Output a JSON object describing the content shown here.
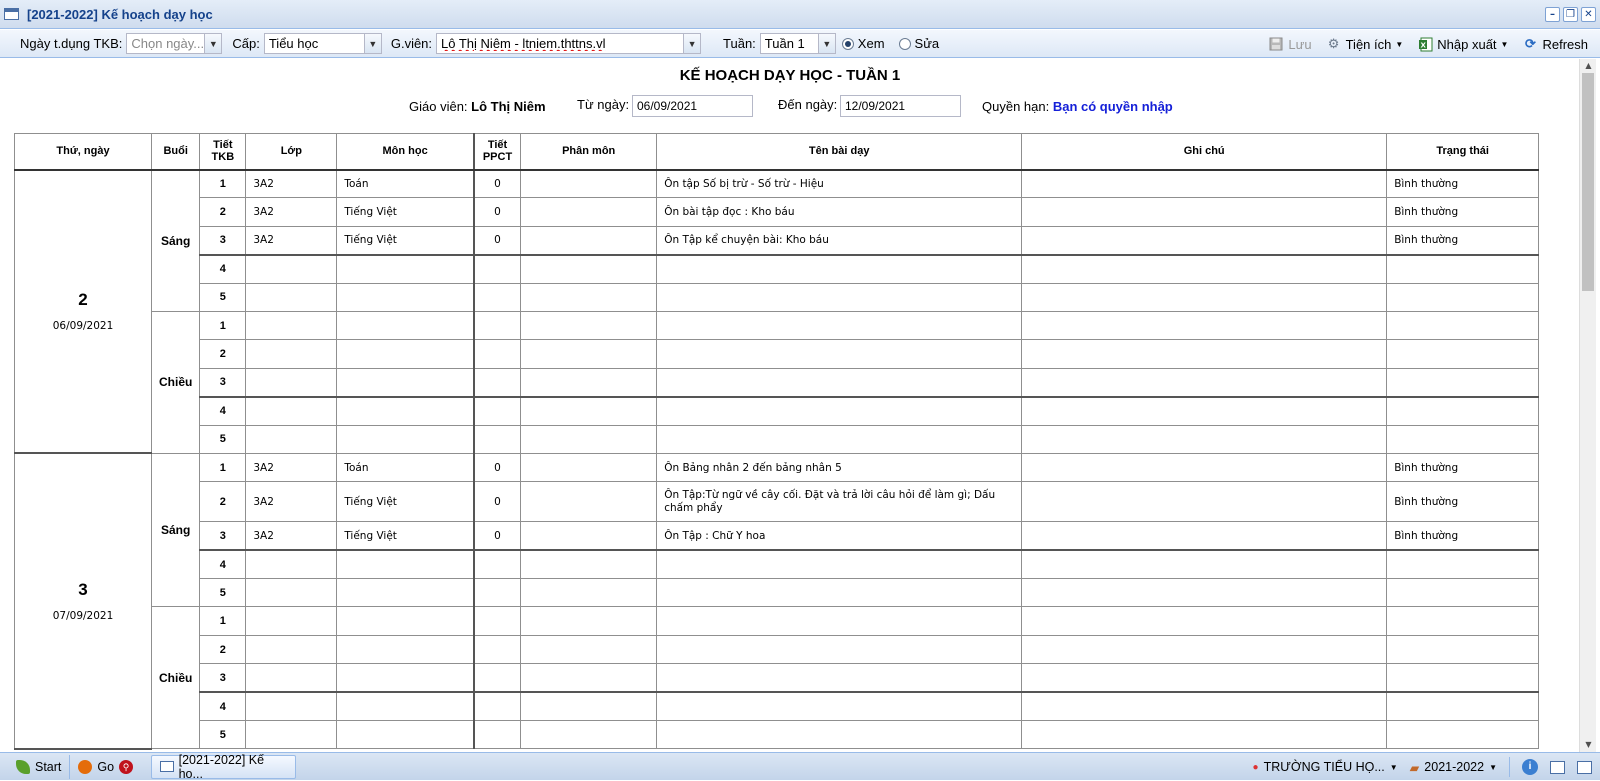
{
  "window": {
    "title": "[2021-2022] Kế hoạch dạy học"
  },
  "toolbar": {
    "ngay_label": "Ngày t.dụng TKB:",
    "ngay_placeholder": "Chọn ngày...",
    "cap_label": "Cấp:",
    "cap_value": "Tiểu học",
    "gv_label": "G.viên:",
    "gv_value": "Lô Thị Niêm - ltniem.thttns.vl",
    "tuan_label": "Tuần:",
    "tuan_value": "Tuần 1",
    "xem_label": "Xem",
    "sua_label": "Sửa",
    "xem_selected": true,
    "luu_label": "Lưu",
    "tienich_label": "Tiện ích",
    "nhapxuat_label": "Nhập xuất",
    "refresh_label": "Refresh"
  },
  "header": {
    "title": "KẾ HOẠCH DẠY HỌC - TUẦN 1",
    "gv_label": "Giáo viên:",
    "gv_name": "Lô Thị Niêm",
    "tu_ngay_label": "Từ ngày:",
    "tu_ngay": "06/09/2021",
    "den_ngay_label": "Đến ngày:",
    "den_ngay": "12/09/2021",
    "quyen_label": "Quyền hạn:",
    "quyen_value": "Bạn có quyền nhập"
  },
  "columns": [
    "Thứ, ngày",
    "Buổi",
    "Tiết TKB",
    "Lớp",
    "Môn học",
    "Tiết PPCT",
    "Phân môn",
    "Tên bài dạy",
    "Ghi chú",
    "Trạng thái"
  ],
  "days": [
    {
      "thu": "2",
      "ngay": "06/09/2021",
      "sessions": [
        {
          "buoi": "Sáng",
          "rows": [
            {
              "tiet": "1",
              "lop": "3A2",
              "mon": "Toán",
              "ppct": "0",
              "phanmon": "",
              "ten": "Ôn tập Số bị trừ - Số trừ - Hiệu",
              "ghichu": "",
              "trangthai": "Bình thường"
            },
            {
              "tiet": "2",
              "lop": "3A2",
              "mon": "Tiếng Việt",
              "ppct": "0",
              "phanmon": "",
              "ten": "Ôn bài tập đọc : Kho báu",
              "ghichu": "",
              "trangthai": "Bình thường"
            },
            {
              "tiet": "3",
              "lop": "3A2",
              "mon": "Tiếng Việt",
              "ppct": "0",
              "phanmon": "",
              "ten": "Ôn Tập kể chuyện bài: Kho báu",
              "ghichu": "",
              "trangthai": "Bình thường"
            },
            {
              "tiet": "4",
              "lop": "",
              "mon": "",
              "ppct": "",
              "phanmon": "",
              "ten": "",
              "ghichu": "",
              "trangthai": ""
            },
            {
              "tiet": "5",
              "lop": "",
              "mon": "",
              "ppct": "",
              "phanmon": "",
              "ten": "",
              "ghichu": "",
              "trangthai": ""
            }
          ]
        },
        {
          "buoi": "Chiều",
          "rows": [
            {
              "tiet": "1",
              "lop": "",
              "mon": "",
              "ppct": "",
              "phanmon": "",
              "ten": "",
              "ghichu": "",
              "trangthai": ""
            },
            {
              "tiet": "2",
              "lop": "",
              "mon": "",
              "ppct": "",
              "phanmon": "",
              "ten": "",
              "ghichu": "",
              "trangthai": ""
            },
            {
              "tiet": "3",
              "lop": "",
              "mon": "",
              "ppct": "",
              "phanmon": "",
              "ten": "",
              "ghichu": "",
              "trangthai": ""
            },
            {
              "tiet": "4",
              "lop": "",
              "mon": "",
              "ppct": "",
              "phanmon": "",
              "ten": "",
              "ghichu": "",
              "trangthai": ""
            },
            {
              "tiet": "5",
              "lop": "",
              "mon": "",
              "ppct": "",
              "phanmon": "",
              "ten": "",
              "ghichu": "",
              "trangthai": ""
            }
          ]
        }
      ]
    },
    {
      "thu": "3",
      "ngay": "07/09/2021",
      "sessions": [
        {
          "buoi": "Sáng",
          "rows": [
            {
              "tiet": "1",
              "lop": "3A2",
              "mon": "Toán",
              "ppct": "0",
              "phanmon": "",
              "ten": "Ôn Bảng nhân 2 đến bảng nhân 5",
              "ghichu": "",
              "trangthai": "Bình thường"
            },
            {
              "tiet": "2",
              "lop": "3A2",
              "mon": "Tiếng Việt",
              "ppct": "0",
              "phanmon": "",
              "ten": "Ôn Tập:Từ ngữ về cây cối. Đặt và trả lời câu hỏi để làm gì; Dấu chấm phẩy",
              "ghichu": "",
              "trangthai": "Bình thường"
            },
            {
              "tiet": "3",
              "lop": "3A2",
              "mon": "Tiếng Việt",
              "ppct": "0",
              "phanmon": "",
              "ten": "Ôn Tập : Chữ Y hoa",
              "ghichu": "",
              "trangthai": "Bình thường"
            },
            {
              "tiet": "4",
              "lop": "",
              "mon": "",
              "ppct": "",
              "phanmon": "",
              "ten": "",
              "ghichu": "",
              "trangthai": ""
            },
            {
              "tiet": "5",
              "lop": "",
              "mon": "",
              "ppct": "",
              "phanmon": "",
              "ten": "",
              "ghichu": "",
              "trangthai": ""
            }
          ]
        },
        {
          "buoi": "Chiều",
          "rows": [
            {
              "tiet": "1",
              "lop": "",
              "mon": "",
              "ppct": "",
              "phanmon": "",
              "ten": "",
              "ghichu": "",
              "trangthai": ""
            },
            {
              "tiet": "2",
              "lop": "",
              "mon": "",
              "ppct": "",
              "phanmon": "",
              "ten": "",
              "ghichu": "",
              "trangthai": ""
            },
            {
              "tiet": "3",
              "lop": "",
              "mon": "",
              "ppct": "",
              "phanmon": "",
              "ten": "",
              "ghichu": "",
              "trangthai": ""
            },
            {
              "tiet": "4",
              "lop": "",
              "mon": "",
              "ppct": "",
              "phanmon": "",
              "ten": "",
              "ghichu": "",
              "trangthai": ""
            },
            {
              "tiet": "5",
              "lop": "",
              "mon": "",
              "ppct": "",
              "phanmon": "",
              "ten": "",
              "ghichu": "",
              "trangthai": ""
            }
          ]
        }
      ]
    }
  ],
  "taskbar": {
    "start_label": "Start",
    "go_label": "Go",
    "active_task": "[2021-2022] Kế ho...",
    "school_label": "TRƯỜNG TIỂU HỌ...",
    "year_label": "2021-2022"
  },
  "colors": {
    "accent": "#15428b",
    "permission": "#1520d8",
    "border": "#99bbe8"
  }
}
